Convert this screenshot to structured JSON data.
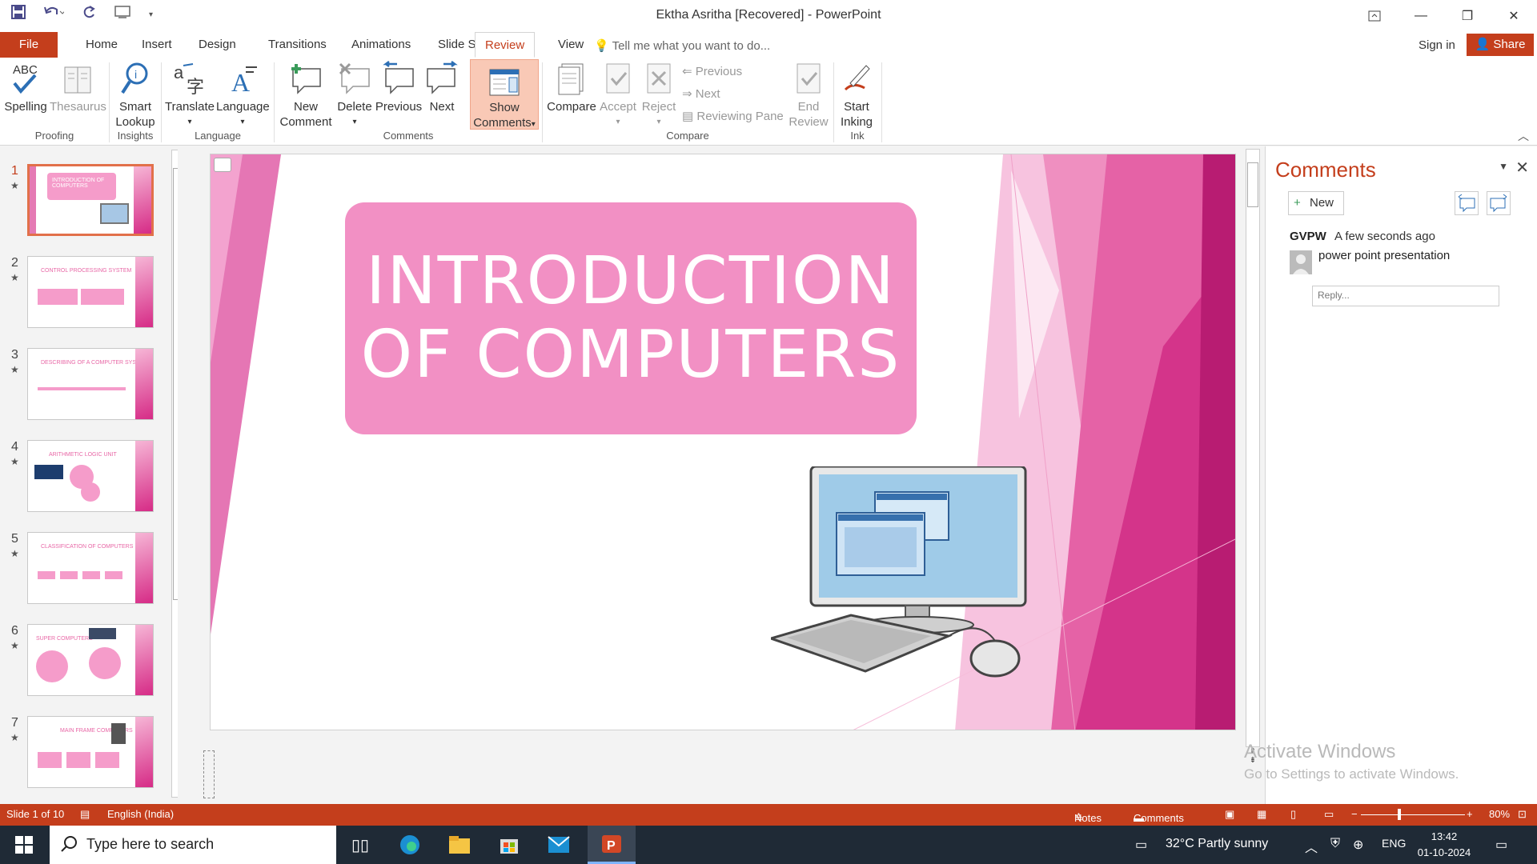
{
  "window": {
    "title": "Ektha Asritha [Recovered] - PowerPoint"
  },
  "tabs": [
    "File",
    "Home",
    "Insert",
    "Design",
    "Transitions",
    "Animations",
    "Slide Show",
    "Review",
    "View"
  ],
  "active_tab": "Review",
  "tell_me": "Tell me what you want to do...",
  "sign_in": "Sign in",
  "share": "Share",
  "ribbon": {
    "proofing": {
      "spelling": "Spelling",
      "thesaurus": "Thesaurus",
      "group": "Proofing"
    },
    "insights": {
      "smart1": "Smart",
      "smart2": "Lookup",
      "group": "Insights"
    },
    "language": {
      "translate": "Translate",
      "language": "Language",
      "group": "Language"
    },
    "comments": {
      "new1": "New",
      "new2": "Comment",
      "delete": "Delete",
      "previous": "Previous",
      "next": "Next",
      "show1": "Show",
      "show2": "Comments",
      "group": "Comments"
    },
    "compare": {
      "compare": "Compare",
      "accept": "Accept",
      "reject": "Reject",
      "previous": "Previous",
      "next": "Next",
      "reviewing_pane": "Reviewing Pane",
      "end1": "End",
      "end2": "Review",
      "group": "Compare"
    },
    "ink": {
      "start1": "Start",
      "start2": "Inking",
      "group": "Ink"
    },
    "spelling_abc": "ABC"
  },
  "thumbnails": [
    {
      "num": "1",
      "title": "INTRODUCTION OF COMPUTERS",
      "active": true
    },
    {
      "num": "2",
      "title": "CONTROL PROCESSING SYSTEM"
    },
    {
      "num": "3",
      "title": "DESCRIBING OF A COMPUTER SYSTEM"
    },
    {
      "num": "4",
      "title": "ARITHMETIC LOGIC UNIT"
    },
    {
      "num": "5",
      "title": "CLASSIFICATION OF COMPUTERS"
    },
    {
      "num": "6",
      "title": "SUPER COMPUTERS"
    },
    {
      "num": "7",
      "title": "MAIN FRAME COMPUTERS"
    }
  ],
  "slide": {
    "title_line1": "INTRODUCTION",
    "title_line2": "OF COMPUTERS"
  },
  "comments_pane": {
    "title": "Comments",
    "new_button": "New",
    "author": "GVPW",
    "time": "A few seconds ago",
    "text": "power point presentation",
    "reply_placeholder": "Reply..."
  },
  "watermark": {
    "line1": "Activate Windows",
    "line2": "Go to Settings to activate Windows."
  },
  "status": {
    "slide": "Slide 1 of 10",
    "language": "English (India)",
    "notes": "Notes",
    "comments": "Comments",
    "zoom": "80%"
  },
  "taskbar": {
    "search_placeholder": "Type here to search",
    "weather": "32°C  Partly sunny",
    "lang": "ENG",
    "time": "13:42",
    "date": "01-10-2024"
  },
  "colors": {
    "accent": "#c43e1c",
    "slide_pink": "#f290c4",
    "magenta": "#d62b86"
  }
}
